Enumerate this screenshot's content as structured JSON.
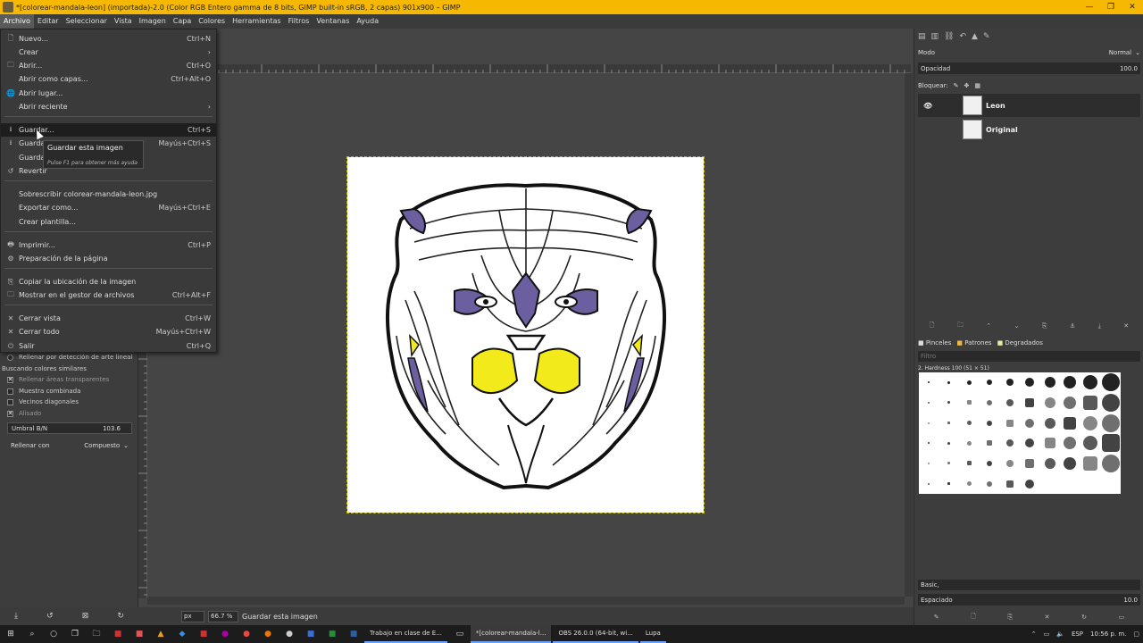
{
  "window": {
    "title": "*[colorear-mandala-leon] (importada)-2.0 (Color RGB Entero gamma de 8 bits, GIMP built-in sRGB, 2 capas) 901x900 – GIMP",
    "controls": [
      "—",
      "❐",
      "✕"
    ]
  },
  "menubar": [
    "Archivo",
    "Editar",
    "Seleccionar",
    "Vista",
    "Imagen",
    "Capa",
    "Colores",
    "Herramientas",
    "Filtros",
    "Ventanas",
    "Ayuda"
  ],
  "file_menu": {
    "items": [
      {
        "icon": "new-file-icon",
        "glyph": "🗋",
        "label": "Nuevo...",
        "shortcut": "Ctrl+N"
      },
      {
        "icon": "",
        "glyph": "",
        "label": "Crear",
        "shortcut": "›"
      },
      {
        "icon": "open-icon",
        "glyph": "🗀",
        "label": "Abrir...",
        "shortcut": "Ctrl+O"
      },
      {
        "icon": "",
        "glyph": "",
        "label": "Abrir como capas...",
        "shortcut": "Ctrl+Alt+O"
      },
      {
        "icon": "globe-icon",
        "glyph": "🌐",
        "label": "Abrir lugar...",
        "shortcut": ""
      },
      {
        "icon": "",
        "glyph": "",
        "label": "Abrir reciente",
        "shortcut": "›"
      },
      {
        "icon": "save-icon",
        "glyph": "⭳",
        "label": "Guardar...",
        "shortcut": "Ctrl+S"
      },
      {
        "icon": "save-as-icon",
        "glyph": "⭳",
        "label": "Guardar",
        "shortcut": "Mayús+Ctrl+S"
      },
      {
        "icon": "",
        "glyph": "",
        "label": "Guardar",
        "shortcut": ""
      },
      {
        "icon": "revert-icon",
        "glyph": "↺",
        "label": "Revertir",
        "shortcut": ""
      },
      {
        "icon": "",
        "glyph": "",
        "label": "Sobrescribir colorear-mandala-leon.jpg",
        "shortcut": ""
      },
      {
        "icon": "",
        "glyph": "",
        "label": "Exportar como...",
        "shortcut": "Mayús+Ctrl+E"
      },
      {
        "icon": "",
        "glyph": "",
        "label": "Crear plantilla...",
        "shortcut": ""
      },
      {
        "icon": "print-icon",
        "glyph": "🖶",
        "label": "Imprimir...",
        "shortcut": "Ctrl+P"
      },
      {
        "icon": "page-setup-icon",
        "glyph": "⚙",
        "label": "Preparación de la página",
        "shortcut": ""
      },
      {
        "icon": "copy-location-icon",
        "glyph": "⎘",
        "label": "Copiar la ubicación de la imagen",
        "shortcut": ""
      },
      {
        "icon": "folder-icon",
        "glyph": "🗀",
        "label": "Mostrar en el gestor de archivos",
        "shortcut": "Ctrl+Alt+F"
      },
      {
        "icon": "close-view-icon",
        "glyph": "✕",
        "label": "Cerrar vista",
        "shortcut": "Ctrl+W"
      },
      {
        "icon": "close-all-icon",
        "glyph": "✕",
        "label": "Cerrar todo",
        "shortcut": "Mayús+Ctrl+W"
      },
      {
        "icon": "quit-icon",
        "glyph": "⏻",
        "label": "Salir",
        "shortcut": "Ctrl+Q"
      }
    ],
    "tooltip_title": "Guardar esta imagen",
    "tooltip_help": "Pulse F1 para obtener más ayuda"
  },
  "tool_options": {
    "fill_lineart": "Rellenar por detección de arte lineal",
    "similar_colors": "Buscando colores similares",
    "fill_transparent": "Rellenar áreas transparentes",
    "sample_merged": "Muestra combinada",
    "diagonal_neighbors": "Vecinos diagonales",
    "antialias": "Alisado",
    "threshold_label": "Umbral B/N",
    "threshold_value": "103.6",
    "fill_by_label": "Rellenar con",
    "fill_by_value": "Compuesto",
    "left_icons": [
      "⤓",
      "↺",
      "⊠",
      "↻"
    ]
  },
  "status": {
    "unit": "px",
    "zoom": "66.7 %",
    "message": "Guardar esta imagen"
  },
  "layers": {
    "mode_label": "Modo",
    "mode_value": "Normal",
    "opacity_label": "Opacidad",
    "opacity_value": "100.0",
    "lock_label": "Bloquear:",
    "items": [
      {
        "name": "Leon",
        "selected": true
      },
      {
        "name": "Original",
        "selected": false
      }
    ]
  },
  "brushes": {
    "tabs": [
      "Pinceles",
      "Patrones",
      "Degradados"
    ],
    "filter_placeholder": "Filtro",
    "current_brush": "2. Hardness 100 (51 × 51)",
    "preset": "Basic,",
    "spacing_label": "Espaciado",
    "spacing_value": "10.0"
  },
  "taskbar": {
    "apps": [
      {
        "label": "Trabajo en clase de E...",
        "active": false
      },
      {
        "label": "*[colorear-mandala-l...",
        "active": true
      },
      {
        "label": "OBS 26.0.0 (64-bit, wi...",
        "active": false
      },
      {
        "label": "Lupa",
        "active": false
      }
    ],
    "lang": "ESP",
    "time": "10:56 p. m."
  },
  "colors": {
    "titlebar": "#f6b800",
    "accent_purple": "#6b5fa0",
    "accent_yellow": "#f2ea1a"
  }
}
